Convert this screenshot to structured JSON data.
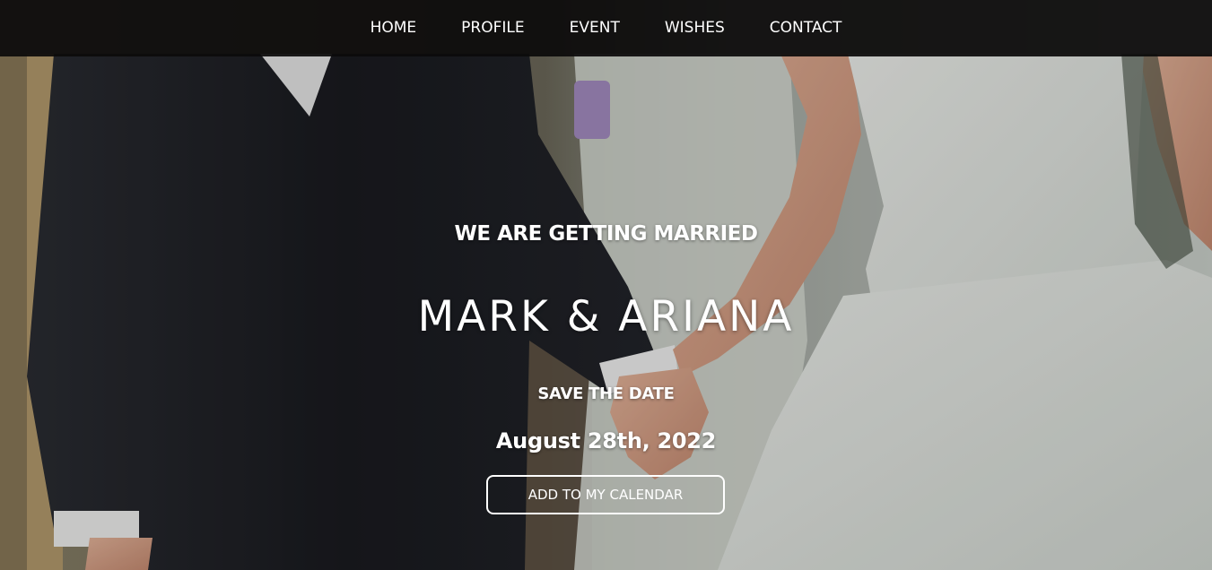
{
  "nav": {
    "items": [
      {
        "label": "HOME"
      },
      {
        "label": "PROFILE"
      },
      {
        "label": "EVENT"
      },
      {
        "label": "WISHES"
      },
      {
        "label": "CONTACT"
      }
    ]
  },
  "hero": {
    "subtitle": "WE ARE GETTING MARRIED",
    "couple": "MARK & ARIANA",
    "save_label": "SAVE THE DATE",
    "date": "August 28th, 2022",
    "calendar_button": "ADD TO MY CALENDAR"
  },
  "colors": {
    "navbar": "#0c0b0b",
    "text": "#ffffff",
    "suit": "#1c1d22",
    "dress": "#e4e8e3"
  }
}
